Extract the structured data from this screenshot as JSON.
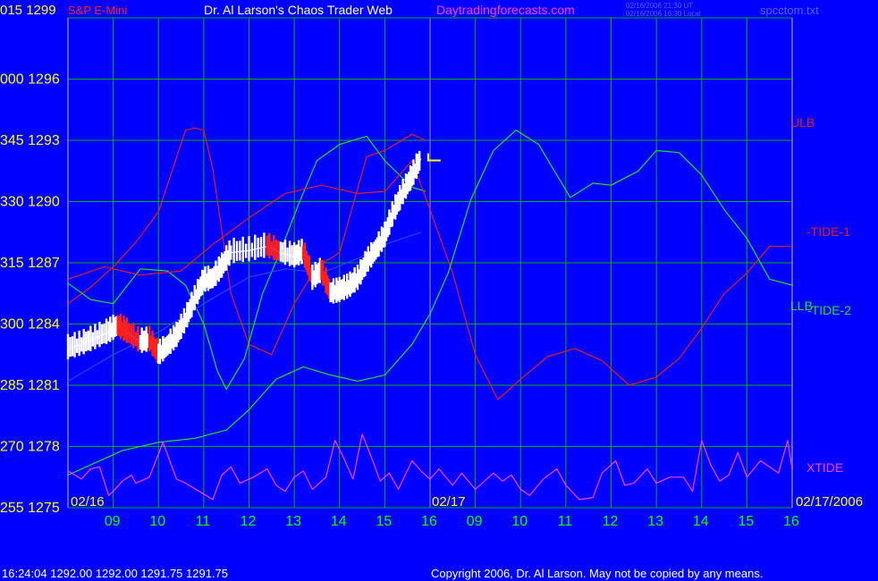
{
  "header": {
    "left_corner": "015  1299",
    "brand": "S&P E-Mini",
    "title": "Dr. Al Larson's Chaos Trader Web",
    "site": "Daytradingforecasts.com",
    "stamp_line1": "02/16/2006 21:30 UT",
    "stamp_line2": "02/16/2006 16:30 Local",
    "file": "spcctom.txt"
  },
  "footer": {
    "quote": "16:24:04   1292.00  1292.00  1291.75  1291.75",
    "copyright": "Copyright 2006, Dr. Al Larson. May not be copied by any means."
  },
  "chart_data": {
    "type": "line",
    "title": "Dr. Al Larson's Chaos Trader Web",
    "y_axis": {
      "labels": [
        "015  1299",
        "000  1296",
        "345  1293",
        "330  1290",
        "315  1287",
        "300  1284",
        "285  1281",
        "270  1278",
        "255  1275"
      ],
      "range": [
        1275,
        1299
      ],
      "step": 3
    },
    "x_axis": {
      "tick_labels": [
        "09",
        "10",
        "11",
        "12",
        "13",
        "14",
        "15",
        "16",
        "09",
        "10",
        "11",
        "12",
        "13",
        "14",
        "15",
        "16"
      ],
      "date_labels": [
        "02/16",
        "02/17",
        "02/17/2006"
      ],
      "range": [
        0,
        16
      ]
    },
    "grid": true,
    "colors": {
      "background": "#0000ff",
      "grid": "#00b000",
      "price": "#ffffff",
      "price_down": "#ff2020",
      "ulb": "#e02020",
      "llb": "#20e020",
      "tide1": "#e02020",
      "tide2": "#20e020",
      "xtide": "#ff40ff",
      "ma": "#3040ff",
      "axis_text": "#ffff00",
      "hour_text": "#00ff00"
    },
    "series": [
      {
        "name": "ULB",
        "color": "#e02020",
        "points": [
          [
            0,
            1285
          ],
          [
            0.5,
            1285.8
          ],
          [
            1,
            1286.8
          ],
          [
            1.5,
            1288
          ],
          [
            2,
            1289.5
          ],
          [
            2.6,
            1293.5
          ],
          [
            2.8,
            1293.6
          ],
          [
            3,
            1293.5
          ],
          [
            3.2,
            1291.6
          ],
          [
            3.6,
            1285.5
          ],
          [
            4,
            1283
          ],
          [
            4.5,
            1282.5
          ],
          [
            5,
            1285
          ],
          [
            5.5,
            1286.8
          ],
          [
            6,
            1287.5
          ],
          [
            6.6,
            1292.2
          ],
          [
            7,
            1292.5
          ],
          [
            7.6,
            1293.3
          ],
          [
            7.9,
            1293
          ]
        ]
      },
      {
        "name": "LLB",
        "color": "#20e020",
        "points": [
          [
            0,
            1286
          ],
          [
            0.5,
            1285.2
          ],
          [
            1,
            1285
          ],
          [
            1.6,
            1286.7
          ],
          [
            2.2,
            1286.6
          ],
          [
            2.6,
            1285.9
          ],
          [
            3,
            1284
          ],
          [
            3.3,
            1281.7
          ],
          [
            3.5,
            1280.8
          ],
          [
            3.9,
            1282.3
          ],
          [
            4.3,
            1285.5
          ],
          [
            4.7,
            1287.6
          ],
          [
            5.1,
            1289.9
          ],
          [
            5.5,
            1292
          ],
          [
            6,
            1292.8
          ],
          [
            6.6,
            1293.2
          ],
          [
            7,
            1292
          ],
          [
            7.6,
            1290.7
          ],
          [
            7.9,
            1290.5
          ]
        ]
      },
      {
        "name": "-TIDE-1",
        "color": "#e02020",
        "points": [
          [
            0,
            1286.2
          ],
          [
            0.8,
            1286.8
          ],
          [
            1.6,
            1286.4
          ],
          [
            2.5,
            1286.6
          ],
          [
            3.2,
            1287.9
          ],
          [
            4,
            1289.2
          ],
          [
            4.8,
            1290.4
          ],
          [
            5.6,
            1290.8
          ],
          [
            6.4,
            1290.4
          ],
          [
            7,
            1290.5
          ],
          [
            7.6,
            1292
          ],
          [
            8,
            1289.6
          ],
          [
            8.5,
            1286.5
          ],
          [
            9,
            1282.5
          ],
          [
            9.5,
            1280.3
          ],
          [
            10,
            1281.3
          ],
          [
            10.6,
            1282.4
          ],
          [
            11.2,
            1282.8
          ],
          [
            11.8,
            1282.2
          ],
          [
            12.4,
            1281
          ],
          [
            13,
            1281.4
          ],
          [
            13.5,
            1282.3
          ],
          [
            14,
            1283.8
          ],
          [
            14.5,
            1285.5
          ],
          [
            15,
            1286.5
          ],
          [
            15.5,
            1287.8
          ],
          [
            16,
            1287.8
          ]
        ]
      },
      {
        "name": "-TIDE-2",
        "color": "#20e020",
        "points": [
          [
            0,
            1276.6
          ],
          [
            0.6,
            1277.2
          ],
          [
            1.2,
            1277.8
          ],
          [
            2,
            1278.2
          ],
          [
            2.8,
            1278.4
          ],
          [
            3.5,
            1278.8
          ],
          [
            4,
            1279.8
          ],
          [
            4.6,
            1281.3
          ],
          [
            5.2,
            1281.9
          ],
          [
            5.8,
            1281.5
          ],
          [
            6.4,
            1281.2
          ],
          [
            7,
            1281.5
          ],
          [
            7.6,
            1283
          ],
          [
            8,
            1284.5
          ],
          [
            8.4,
            1286.5
          ],
          [
            8.9,
            1290.1
          ],
          [
            9.4,
            1292.5
          ],
          [
            9.9,
            1293.5
          ],
          [
            10.4,
            1292.8
          ],
          [
            10.8,
            1291.3
          ],
          [
            11.1,
            1290.2
          ],
          [
            11.6,
            1290.9
          ],
          [
            12,
            1290.8
          ],
          [
            12.6,
            1291.5
          ],
          [
            13,
            1292.5
          ],
          [
            13.5,
            1292.4
          ],
          [
            14,
            1291.3
          ],
          [
            14.5,
            1289.6
          ],
          [
            15,
            1288.2
          ],
          [
            15.5,
            1286.2
          ],
          [
            16,
            1285.9
          ]
        ]
      },
      {
        "name": "XTIDE",
        "color": "#ff40ff",
        "points": [
          [
            0,
            1276.8
          ],
          [
            0.3,
            1276.4
          ],
          [
            0.5,
            1276.9
          ],
          [
            0.7,
            1277
          ],
          [
            0.9,
            1275.6
          ],
          [
            1,
            1275.8
          ],
          [
            1.2,
            1276.3
          ],
          [
            1.4,
            1276.6
          ],
          [
            1.5,
            1276.2
          ],
          [
            1.8,
            1276.5
          ],
          [
            2.1,
            1278.2
          ],
          [
            2.4,
            1276.4
          ],
          [
            2.6,
            1276.2
          ],
          [
            2.9,
            1275.8
          ],
          [
            3.2,
            1275.4
          ],
          [
            3.4,
            1276.6
          ],
          [
            3.6,
            1277
          ],
          [
            3.8,
            1276.2
          ],
          [
            4.1,
            1276.5
          ],
          [
            4.4,
            1276.9
          ],
          [
            4.6,
            1276.1
          ],
          [
            4.8,
            1275.8
          ],
          [
            5,
            1276.5
          ],
          [
            5.2,
            1276.8
          ],
          [
            5.4,
            1275.9
          ],
          [
            5.7,
            1276.5
          ],
          [
            5.9,
            1278.3
          ],
          [
            6.1,
            1277.4
          ],
          [
            6.3,
            1276.4
          ],
          [
            6.5,
            1278.6
          ],
          [
            6.7,
            1277.5
          ],
          [
            6.9,
            1276.3
          ],
          [
            7.1,
            1276.7
          ],
          [
            7.3,
            1275.9
          ],
          [
            7.6,
            1277.3
          ],
          [
            7.8,
            1276.8
          ],
          [
            8,
            1276.4
          ],
          [
            8.2,
            1276.9
          ],
          [
            8.5,
            1276.1
          ],
          [
            8.7,
            1276.7
          ],
          [
            9,
            1275.9
          ],
          [
            9.4,
            1276.7
          ],
          [
            9.6,
            1276.3
          ],
          [
            9.8,
            1276.6
          ],
          [
            10,
            1275.9
          ],
          [
            10.2,
            1275.6
          ],
          [
            10.5,
            1276.4
          ],
          [
            10.8,
            1276.9
          ],
          [
            11,
            1276.1
          ],
          [
            11.3,
            1275.4
          ],
          [
            11.6,
            1275.5
          ],
          [
            11.8,
            1276.7
          ],
          [
            12.1,
            1277.3
          ],
          [
            12.3,
            1276.1
          ],
          [
            12.5,
            1276.2
          ],
          [
            12.8,
            1276.9
          ],
          [
            13,
            1276.2
          ],
          [
            13.3,
            1276.5
          ],
          [
            13.6,
            1276.5
          ],
          [
            13.8,
            1275.8
          ],
          [
            14,
            1278.3
          ],
          [
            14.2,
            1277.1
          ],
          [
            14.4,
            1276.3
          ],
          [
            14.6,
            1276.6
          ],
          [
            14.8,
            1277.7
          ],
          [
            15,
            1276.5
          ],
          [
            15.3,
            1277.3
          ],
          [
            15.5,
            1277
          ],
          [
            15.7,
            1276.7
          ],
          [
            15.9,
            1278.3
          ],
          [
            16,
            1276.9
          ]
        ]
      },
      {
        "name": "MA",
        "color": "#3040ff",
        "points": [
          [
            0,
            1281.2
          ],
          [
            1,
            1282.5
          ],
          [
            2,
            1283.6
          ],
          [
            3,
            1285
          ],
          [
            4,
            1286.3
          ],
          [
            4.8,
            1286.7
          ],
          [
            5.6,
            1286.5
          ],
          [
            6.4,
            1287.2
          ],
          [
            7,
            1287.9
          ],
          [
            7.8,
            1288.5
          ]
        ]
      },
      {
        "name": "Price",
        "color": "#ffffff",
        "points": [
          [
            0,
            1282.8
          ],
          [
            0.3,
            1283
          ],
          [
            0.6,
            1283.3
          ],
          [
            0.9,
            1283.6
          ],
          [
            1.1,
            1283.9
          ],
          [
            1.3,
            1283.6
          ],
          [
            1.6,
            1283.1
          ],
          [
            1.8,
            1283.2
          ],
          [
            2,
            1282.5
          ],
          [
            2.2,
            1282.9
          ],
          [
            2.4,
            1283.4
          ],
          [
            2.6,
            1284.2
          ],
          [
            2.8,
            1285.2
          ],
          [
            3,
            1286.1
          ],
          [
            3.2,
            1286.2
          ],
          [
            3.4,
            1286.8
          ],
          [
            3.6,
            1287.5
          ],
          [
            4,
            1287.6
          ],
          [
            4.4,
            1287.8
          ],
          [
            4.7,
            1287.5
          ],
          [
            5,
            1287.3
          ],
          [
            5.2,
            1287.5
          ],
          [
            5.4,
            1286.2
          ],
          [
            5.6,
            1286.6
          ],
          [
            5.8,
            1285.5
          ],
          [
            6,
            1285.6
          ],
          [
            6.2,
            1285.8
          ],
          [
            6.4,
            1286.2
          ],
          [
            6.6,
            1287
          ],
          [
            6.8,
            1287.6
          ],
          [
            7,
            1288.3
          ],
          [
            7.2,
            1289.5
          ],
          [
            7.4,
            1290.4
          ],
          [
            7.6,
            1291.2
          ],
          [
            7.8,
            1292.1
          ]
        ]
      }
    ],
    "annotations": {
      "ulb": "ULB",
      "tide1": "-TIDE-1",
      "llb": "LLB",
      "tide2": "-TIDE-2",
      "xtide": "XTIDE"
    }
  }
}
